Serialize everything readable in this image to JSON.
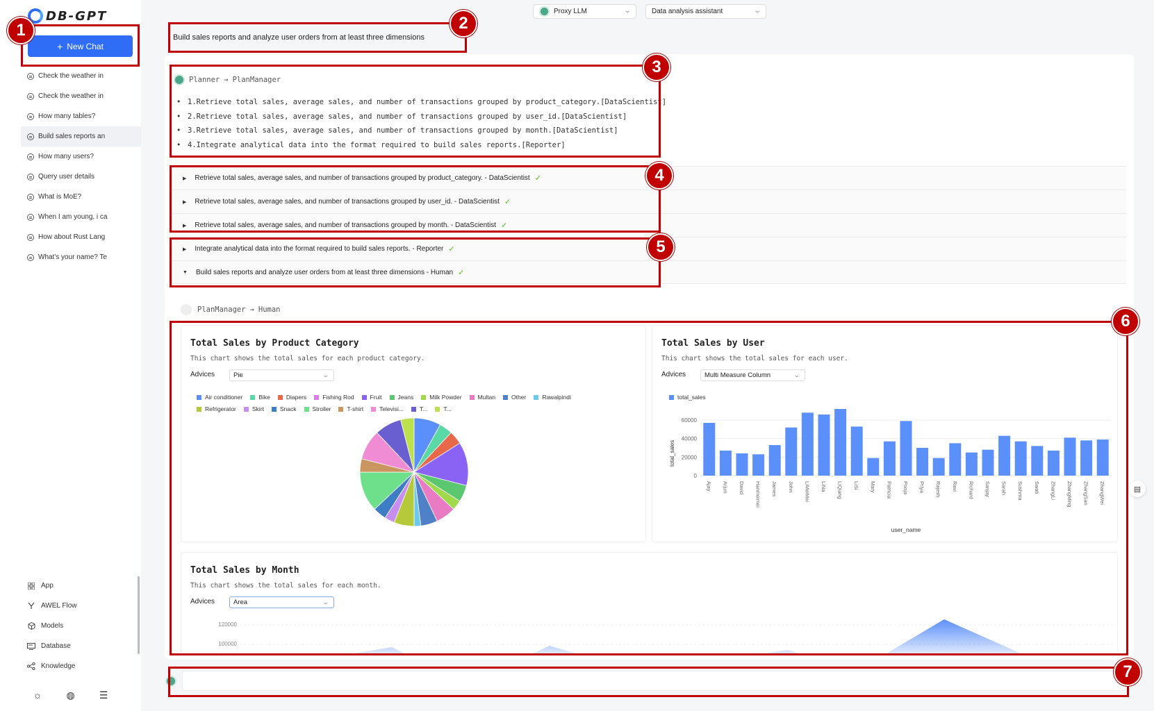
{
  "app": {
    "logo_text": "DB-GPT"
  },
  "sidebar": {
    "new_chat_label": "New Chat",
    "chats": [
      "Check the weather in",
      "Check the weather in",
      "How many tables?",
      "Build sales reports an",
      "How many users?",
      "Query user details",
      "What is MoE?",
      "When I am young, i ca",
      "How about Rust Lang",
      "What's your name? Te"
    ],
    "active_chat_index": 3,
    "nav": [
      {
        "label": "App",
        "icon": "grid-icon"
      },
      {
        "label": "AWEL Flow",
        "icon": "flow-icon"
      },
      {
        "label": "Models",
        "icon": "cube-icon"
      },
      {
        "label": "Database",
        "icon": "database-icon"
      },
      {
        "label": "Knowledge",
        "icon": "knowledge-icon"
      }
    ],
    "bottom_icons": [
      "sun-icon",
      "globe-icon",
      "menu-collapse-icon"
    ]
  },
  "header": {
    "model_select": "Proxy LLM",
    "assistant_select": "Data analysis assistant"
  },
  "conversation": {
    "user_message": "Build sales reports and analyze user orders from at least three dimensions",
    "planner_header": {
      "from": "Planner",
      "to": "PlanManager"
    },
    "plan": [
      "1.Retrieve total sales, average sales, and number of transactions grouped by product_category.[DataScientist]",
      "2.Retrieve total sales, average sales, and number of transactions grouped by user_id.[DataScientist]",
      "3.Retrieve total sales, average sales, and number of transactions grouped by month.[DataScientist]",
      "4.Integrate analytical data into the format required to build sales reports.[Reporter]"
    ],
    "steps": [
      {
        "text": "Retrieve total sales, average sales, and number of transactions grouped by product_category. - DataScientist",
        "expanded": false
      },
      {
        "text": "Retrieve total sales, average sales, and number of transactions grouped by user_id. - DataScientist",
        "expanded": false
      },
      {
        "text": "Retrieve total sales, average sales, and number of transactions grouped by month. - DataScientist",
        "expanded": false
      },
      {
        "text": "Integrate analytical data into the format required to build sales reports. - Reporter",
        "expanded": false
      },
      {
        "text": "Build sales reports and analyze user orders from at least three dimensions - Human",
        "expanded": true
      }
    ],
    "step_status_icon": "check-icon",
    "reply_header": {
      "from": "PlanManager",
      "to": "Human"
    },
    "advices_label": "Advices"
  },
  "annotation_numbers": [
    "1",
    "2",
    "3",
    "4",
    "5",
    "6",
    "7"
  ],
  "colors": {
    "accent": "#2f6df6",
    "annotation": "#c00000",
    "check": "#52c41a"
  },
  "chart_data": [
    {
      "type": "pie",
      "title": "Total Sales by Product Category",
      "description": "This chart shows the total sales for each product category.",
      "advice": "Pie",
      "categories": [
        "Air conditioner",
        "Bike",
        "Diapers",
        "Fishing Rod",
        "Fruit",
        "Jeans",
        "Milk Powder",
        "Multan",
        "Other",
        "Rawalpindi",
        "Refrigerator",
        "Skirt",
        "Snack",
        "Stroller",
        "T-shirt",
        "Televisi...",
        "T...",
        "T..."
      ],
      "legend_labels": [
        "Air conditioner",
        "Bike",
        "Diapers",
        "Fishing Rod",
        "Fruit",
        "Jeans",
        "Milk Powder",
        "Multan",
        "Other",
        "Rawalpindi",
        "Refrigerator",
        "Skirt",
        "Snack",
        "Stroller",
        "T-shirt",
        "Televisi...",
        "T...",
        "T..."
      ],
      "colors": [
        "#5b8ff9",
        "#5ad8a6",
        "#e8684a",
        "#d87fe8",
        "#8a63f5",
        "#5bc86f",
        "#a0d94a",
        "#e87bc4",
        "#4f80c8",
        "#6dc8ec",
        "#b5c93a",
        "#c78ef0",
        "#3d7dc4",
        "#6ee08c",
        "#c99560",
        "#f08cd4",
        "#6a5fd0",
        "#bde04f"
      ],
      "values": [
        8,
        4,
        4,
        0,
        13,
        5,
        3,
        6,
        5,
        2,
        6,
        3,
        4,
        12,
        4,
        9,
        8,
        4
      ]
    },
    {
      "type": "bar",
      "title": "Total Sales by User",
      "description": "This chart shows the total sales for each user.",
      "advice": "Multi Measure Column",
      "legend": [
        "total_sales"
      ],
      "xlabel": "user_name",
      "ylabel": "total_sales",
      "yticks": [
        "0",
        "20000",
        "40000",
        "60000"
      ],
      "ylim": [
        0,
        75000
      ],
      "categories": [
        "Ajay",
        "Arjun",
        "David",
        "Hanmeimei",
        "James",
        "John",
        "LiMeiMei",
        "LiNa",
        "LiQiang",
        "LiSi",
        "Mary",
        "Patricia",
        "Pooja",
        "Priya",
        "Rajesh",
        "Ravi",
        "Richard",
        "Sanjay",
        "Sarah",
        "Sushma",
        "Swati",
        "ZhangLi",
        "ZhangMing",
        "ZhangSan",
        "ZhangWei"
      ],
      "series": [
        {
          "name": "total_sales",
          "values": [
            57000,
            27000,
            24000,
            23000,
            33000,
            52000,
            68000,
            66000,
            72000,
            53000,
            19000,
            37000,
            59000,
            30000,
            19000,
            35000,
            25000,
            28000,
            43000,
            37000,
            32000,
            27000,
            41000,
            38000,
            39000
          ]
        }
      ],
      "color": "#5b8ff9"
    },
    {
      "type": "area",
      "title": "Total Sales by Month",
      "description": "This chart shows the total sales for each month.",
      "advice": "Area",
      "yticks": [
        "120000",
        "100000"
      ],
      "ylim": [
        0,
        130000
      ],
      "color": "#5b8ff9"
    }
  ]
}
